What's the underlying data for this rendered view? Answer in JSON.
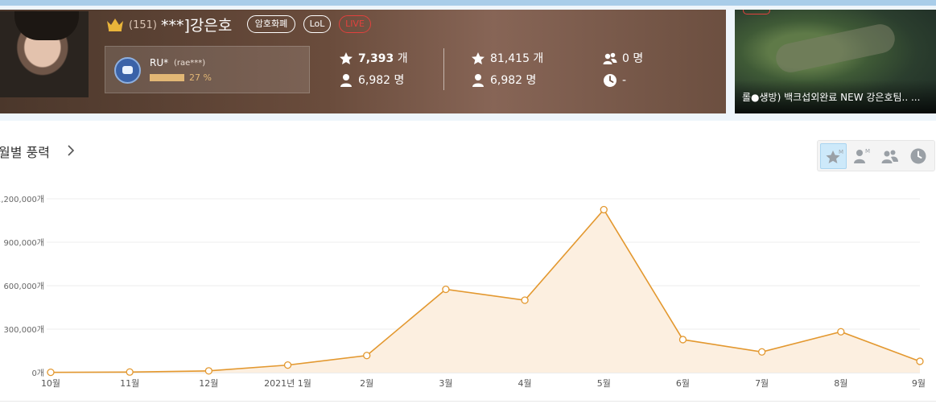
{
  "profile": {
    "level": "(151)",
    "bj_name": "***]강은호",
    "tags": [
      "암호화폐",
      "LoL",
      "LIVE"
    ],
    "fanclub": {
      "name": "RU*",
      "id": "(rae***)",
      "percent": "27 %",
      "progress": 0.27
    },
    "stats": {
      "balloons_monthly": "7,393",
      "balloons_monthly_unit": "개",
      "fans_monthly": "6,982 명",
      "balloons_total": "81,415 개",
      "fans_total": "6,982 명",
      "viewers": "0 명",
      "time": "-"
    },
    "icons": [
      "crown-icon",
      "star-icon",
      "user-icon",
      "users-icon",
      "clock-icon"
    ]
  },
  "thumbnail": {
    "title": "롤●생방) 백크섭외완료 NEW 강은호팀.. ..."
  },
  "section": {
    "title": "월별 풍력"
  },
  "chart_data": {
    "type": "area",
    "x": [
      "10월",
      "11월",
      "12월",
      "2021년 1월",
      "2월",
      "3월",
      "4월",
      "5월",
      "6월",
      "7월",
      "8월",
      "9월"
    ],
    "values": [
      2000,
      4000,
      12000,
      52000,
      118000,
      575000,
      500000,
      1125000,
      228000,
      143000,
      282000,
      78000
    ],
    "ylim": [
      0,
      1200000
    ],
    "yticks": [
      "0개",
      "300,000개",
      "600,000개",
      "900,000개",
      "1,200,000개"
    ],
    "line_color": "#e3982f",
    "fill_color": "#fcefe0",
    "grid": true
  }
}
